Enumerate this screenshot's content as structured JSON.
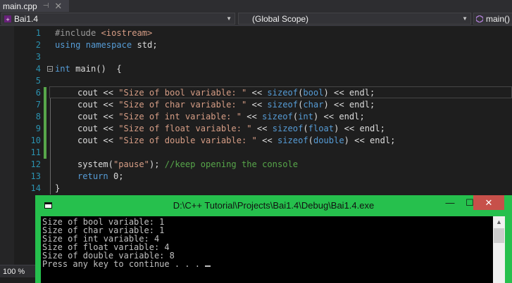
{
  "editor": {
    "tab": {
      "label": "main.cpp",
      "pin": "⊣",
      "close": "✕"
    },
    "nav": {
      "project": "Bai1.4",
      "scope": "(Global Scope)",
      "member": "main()"
    },
    "zoom": "100 %",
    "lines": [
      {
        "n": "1"
      },
      {
        "n": "2"
      },
      {
        "n": "3"
      },
      {
        "n": "4"
      },
      {
        "n": "5"
      },
      {
        "n": "6"
      },
      {
        "n": "7"
      },
      {
        "n": "8"
      },
      {
        "n": "9"
      },
      {
        "n": "10"
      },
      {
        "n": "11"
      },
      {
        "n": "12"
      },
      {
        "n": "13"
      },
      {
        "n": "14"
      }
    ],
    "code": {
      "l1_pp": "#include",
      "l1_inc": "<iostream>",
      "l2_kw1": "using",
      "l2_kw2": "namespace",
      "l2_rest": " std;",
      "l4_kw": "int",
      "l4_rest": " main()  {",
      "cout": "cout << ",
      "sizeof": "sizeof",
      "endl": " << endl;",
      "l6_str": "\"Size of bool variable: \"",
      "l6_type": "bool",
      "l7_str": "\"Size of char variable: \"",
      "l7_type": "char",
      "l8_str": "\"Size of int variable: \"",
      "l8_type": "int",
      "l9_str": "\"Size of float variable: \"",
      "l9_type": "float",
      "l10_str": "\"Size of double variable: \"",
      "l10_type": "double",
      "l12_fn": "system(",
      "l12_str": "\"pause\"",
      "l12_end": "); ",
      "l12_cm": "//keep opening the console",
      "l13_kw": "return",
      "l13_rest": " 0;",
      "l14": "}"
    }
  },
  "console": {
    "title": "D:\\C++ Tutorial\\Projects\\Bai1.4\\Debug\\Bai1.4.exe",
    "minimize": "—",
    "maximize": "☐",
    "close": "✕",
    "output": [
      "Size of bool variable: 1",
      "Size of char variable: 1",
      "Size of int variable: 4",
      "Size of float variable: 4",
      "Size of double variable: 8",
      "Press any key to continue . . . "
    ]
  },
  "colors": {
    "accent": "#26c04d",
    "editor_bg": "#1e1e1e",
    "close_btn": "#c7504a"
  }
}
